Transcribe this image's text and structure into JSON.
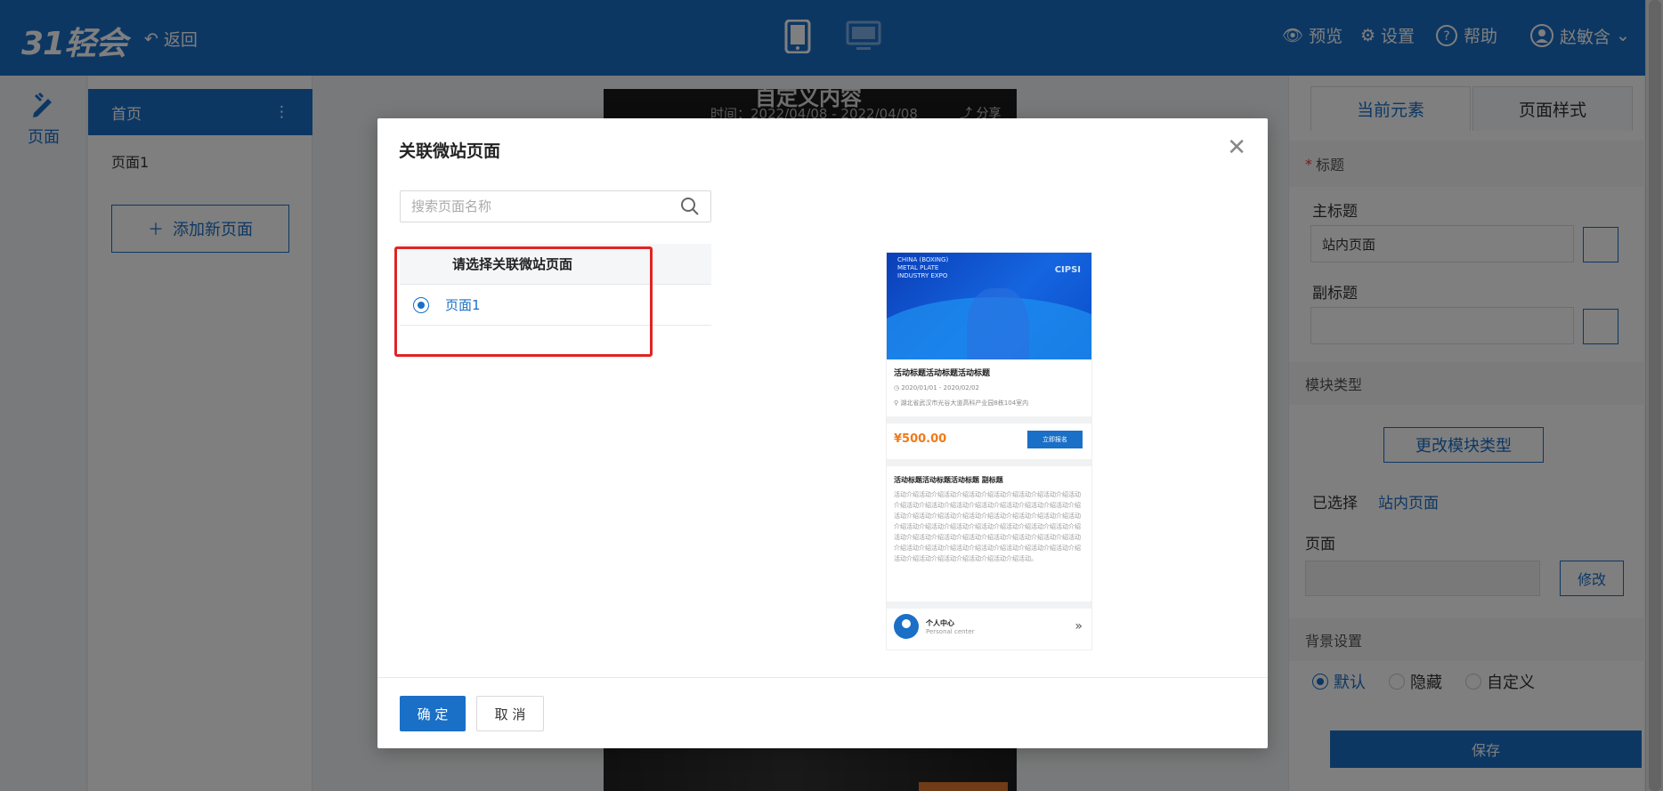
{
  "header": {
    "logo": "31轻会",
    "back_label": "返回",
    "preview_label": "预览",
    "settings_label": "设置",
    "help_label": "帮助",
    "user_name": "赵敏含"
  },
  "rail": {
    "pages_label": "页面"
  },
  "pages_panel": {
    "home_label": "首页",
    "page_item": "页面1",
    "add_page_label": "添加新页面"
  },
  "canvas": {
    "phone_title": "自定义内容",
    "phone_time": "时间：2022/04/08 - 2022/04/08",
    "phone_share": "分享"
  },
  "right_panel": {
    "tab_current": "当前元素",
    "tab_style": "页面样式",
    "section_title": "标题",
    "main_title_label": "主标题",
    "main_title_value": "站内页面",
    "subtitle_label": "副标题",
    "subtitle_value": "",
    "module_type_section": "模块类型",
    "change_module_button": "更改模块类型",
    "selected_label": "已选择",
    "selected_value": "站内页面",
    "page_label": "页面",
    "modify_button": "修改",
    "bg_section": "背景设置",
    "bg_options": [
      "默认",
      "隐藏",
      "自定义"
    ],
    "bg_selected": "默认",
    "save_button": "保存"
  },
  "modal": {
    "title": "关联微站页面",
    "search_placeholder": "搜索页面名称",
    "table_header": "请选择关联微站页面",
    "rows": [
      {
        "label": "页面1",
        "selected": true
      }
    ],
    "confirm_button": "确 定",
    "cancel_button": "取 消"
  },
  "preview": {
    "banner_text": "CHINA (BOXING)\nMETAL PLATE\nINDUSTRY EXPO",
    "banner_logo": "CIPSI",
    "event_title": "活动标题活动标题活动标题",
    "event_date": "2020/01/01 - 2020/02/02",
    "event_location": "湖北省武汉市光谷大道高科产业园8栋104室内",
    "price": "¥500.00",
    "signup_button": "立即报名",
    "subtitle": "活动标题活动标题活动标题  副标题",
    "description": "活动介绍活动介绍活动介绍活动介绍活动介绍活动介绍活动介绍活动介绍活动介绍活动介绍活动介绍活动介绍活动介绍活动介绍活动介绍活动介绍活动介绍活动介绍活动介绍活动介绍活动介绍活动介绍活动介绍活动介绍活动介绍活动介绍活动介绍活动介绍活动介绍活动介绍活动介绍活动介绍活动介绍活动介绍活动介绍活动介绍活动介绍活动介绍活动介绍活动介绍活动介绍活动介绍活动介绍活动介绍活动介绍活动介绍活动介绍活动介绍活动介绍活动介绍活动。",
    "user_center": "个人中心",
    "user_center_en": "Personal center"
  }
}
